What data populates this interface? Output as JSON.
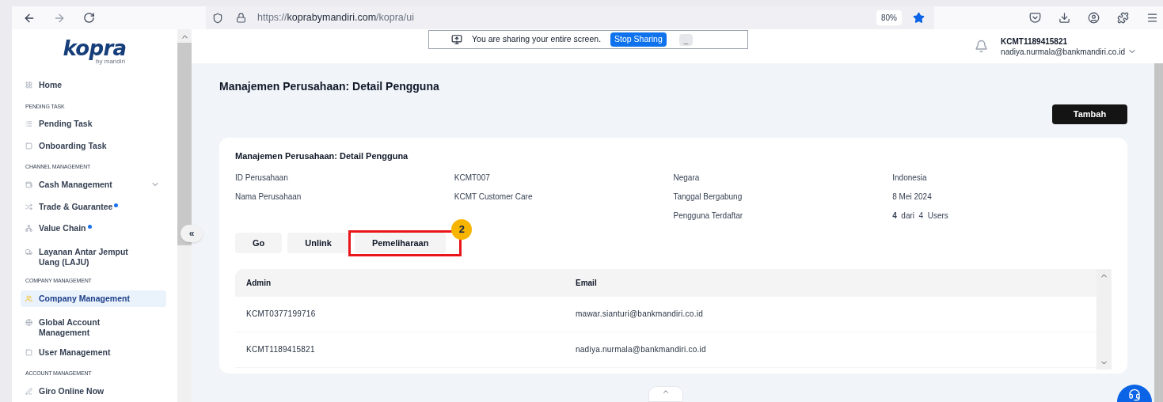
{
  "browser": {
    "url_host": "koprabymandiri.com",
    "url_scheme": "https://",
    "url_path": "/kopra/ui",
    "zoom": "80%"
  },
  "logo": {
    "name": "kopra",
    "tagline": "by mandiri"
  },
  "sidebar": {
    "items": [
      {
        "kind": "link",
        "label": "Home",
        "selected": false,
        "new": false
      },
      {
        "kind": "section",
        "label": "PENDING TASK"
      },
      {
        "kind": "link",
        "label": "Pending Task",
        "selected": false,
        "new": false
      },
      {
        "kind": "link",
        "label": "Onboarding Task",
        "selected": false,
        "new": false
      },
      {
        "kind": "section",
        "label": "CHANNEL MANAGEMENT"
      },
      {
        "kind": "group",
        "label": "Cash Management",
        "selected": false,
        "new": false,
        "expanded": false
      },
      {
        "kind": "link",
        "label": "Trade & Guarantee",
        "selected": false,
        "new": true
      },
      {
        "kind": "link",
        "label": "Value Chain",
        "selected": false,
        "new": true
      },
      {
        "kind": "link",
        "label": "Layanan Antar Jemput Uang (LAJU)",
        "selected": false,
        "new": false
      },
      {
        "kind": "section",
        "label": "COMPANY MANAGEMENT"
      },
      {
        "kind": "link",
        "label": "Company Management",
        "selected": true,
        "new": false
      },
      {
        "kind": "link",
        "label": "Global Account Management",
        "selected": false,
        "new": false
      },
      {
        "kind": "link",
        "label": "User Management",
        "selected": false,
        "new": false
      },
      {
        "kind": "section",
        "label": "ACCOUNT MANAGEMENT"
      },
      {
        "kind": "link",
        "label": "Giro Online Now",
        "selected": false,
        "new": false
      }
    ],
    "collapse": "«"
  },
  "share_bar": {
    "message": "You are sharing your entire screen.",
    "stop": "Stop Sharing",
    "hide": "_"
  },
  "user": {
    "id": "KCMT1189415821",
    "email": "nadiya.nurmala@bankmandiri.co.id"
  },
  "page": {
    "title": "Manajemen Perusahaan: Detail Pengguna",
    "add_button": "Tambah"
  },
  "card": {
    "title": "Manajemen Perusahaan: Detail Pengguna",
    "details_left": [
      {
        "label": "ID Perusahaan",
        "value": "KCMT007"
      },
      {
        "label": "Nama Perusahaan",
        "value": "KCMT Customer Care"
      }
    ],
    "details_right": [
      {
        "label": "Negara",
        "value": "Indonesia"
      },
      {
        "label": "Tanggal Bergabung",
        "value": "8 Mei 2024"
      },
      {
        "label": "Pengguna Terdaftar",
        "value": "**4**  dari  4  Users"
      }
    ],
    "actions": [
      {
        "label": "Go",
        "highlighted": false
      },
      {
        "label": "Unlink",
        "highlighted": false
      },
      {
        "label": "Pemeliharaan",
        "highlighted": true,
        "annotation": "2"
      }
    ],
    "table": {
      "columns": [
        "Admin",
        "Email"
      ],
      "rows": [
        [
          "KCMT0377199716",
          "mawar.sianturi@bankmandiri.co.id"
        ],
        [
          "KCMT1189415821",
          "nadiya.nurmala@bankmandiri.co.id"
        ]
      ]
    }
  }
}
